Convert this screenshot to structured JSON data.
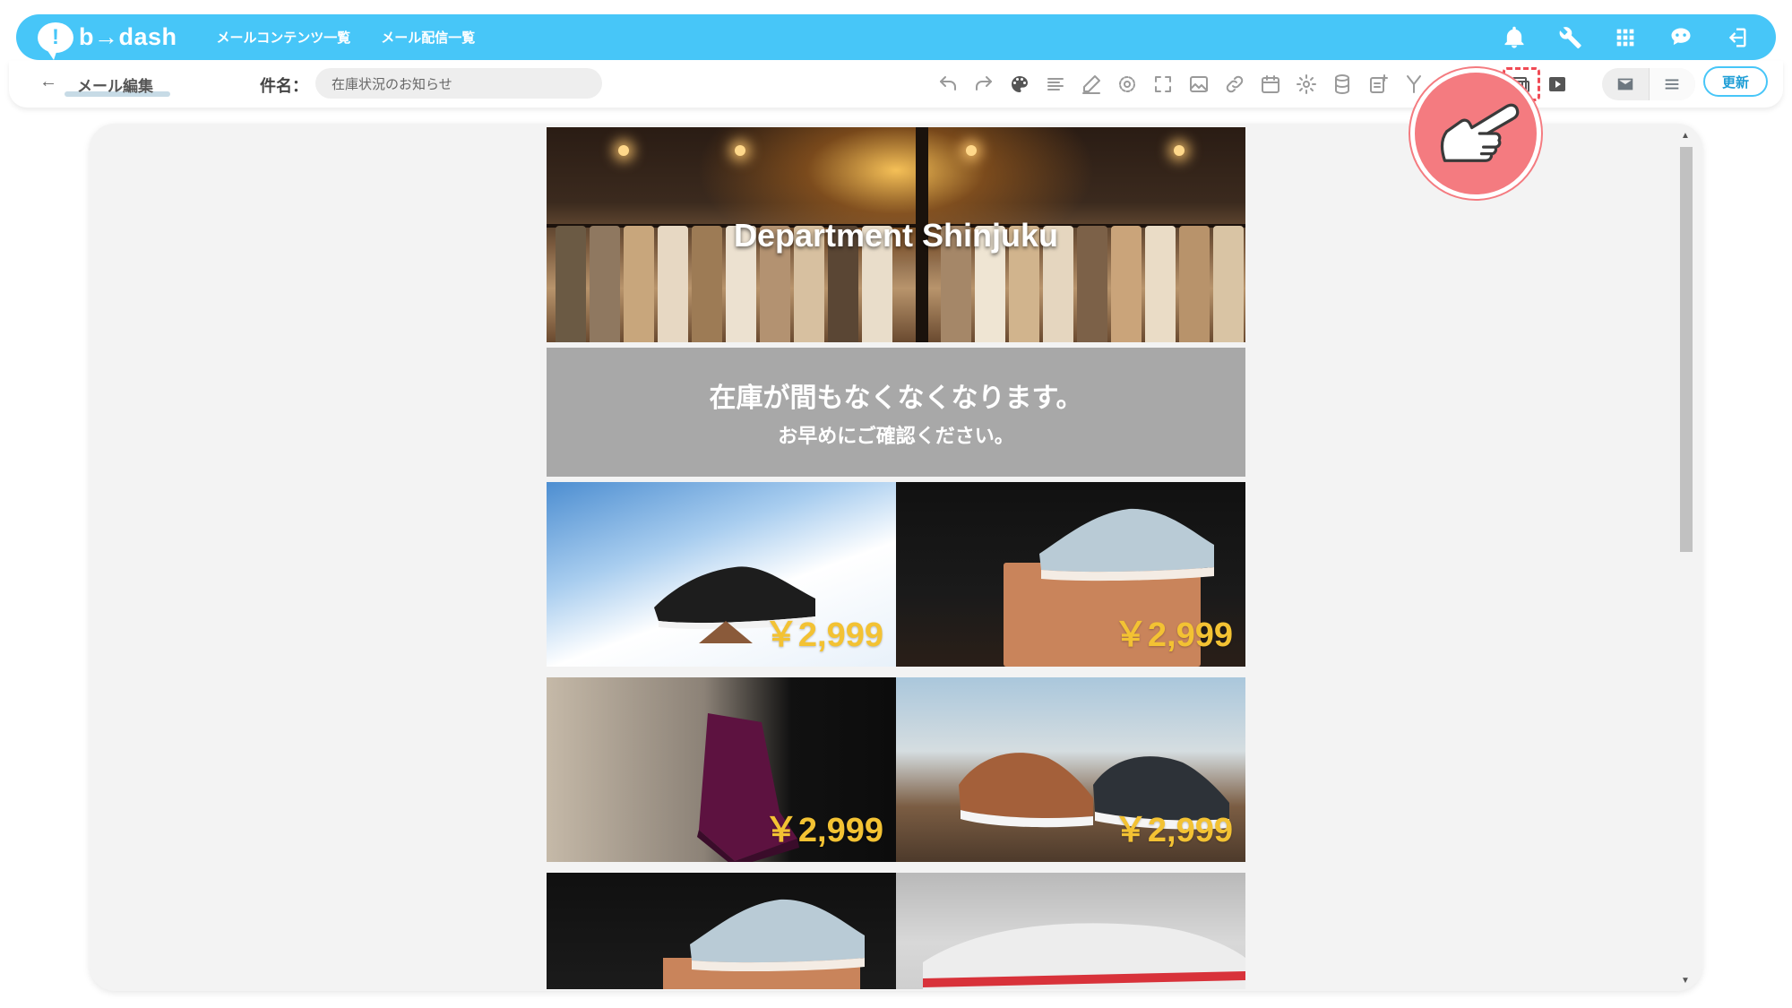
{
  "app": {
    "brand_name": "b→dash",
    "brand_mark": "!",
    "nav": [
      "メールコンテンツ一覧",
      "メール配信一覧"
    ],
    "top_icons": [
      "bell-icon",
      "wrench-icon",
      "grid-apps-icon",
      "robot-icon",
      "logout-icon"
    ]
  },
  "toolbar": {
    "back_glyph": "←",
    "page_title": "メール編集",
    "subject_label": "件名：",
    "subject_value": "在庫状況のお知らせ",
    "tools": [
      "undo-icon",
      "redo-icon",
      "palette-icon",
      "align-icon",
      "pen-icon",
      "target-icon",
      "fullscreen-icon",
      "image-icon",
      "link-icon",
      "calendar-icon",
      "settings-icon",
      "database-icon",
      "note-add-icon",
      "merge-icon",
      "blank",
      "blank",
      "responsive-preview-icon",
      "video-icon"
    ],
    "highlighted_tool": "responsive-preview-icon",
    "view_modes": [
      "mail-icon",
      "list-icon"
    ],
    "update_label": "更新"
  },
  "email": {
    "hero_title": "Department Shinjuku",
    "notice_main": "在庫が間もなくなくなります。",
    "notice_sub": "お早めにご確認ください。",
    "products": [
      {
        "price": "￥2,999"
      },
      {
        "price": "￥2,999"
      },
      {
        "price": "￥2,999"
      },
      {
        "price": "￥2,999"
      },
      {
        "price": ""
      },
      {
        "price": ""
      }
    ]
  },
  "colors": {
    "brand_blue": "#47c6f8",
    "price_yellow": "#f3c233",
    "notice_gray": "#a8a8a8",
    "highlight_red": "#f04a54",
    "pointer_badge": "#f47b80"
  }
}
